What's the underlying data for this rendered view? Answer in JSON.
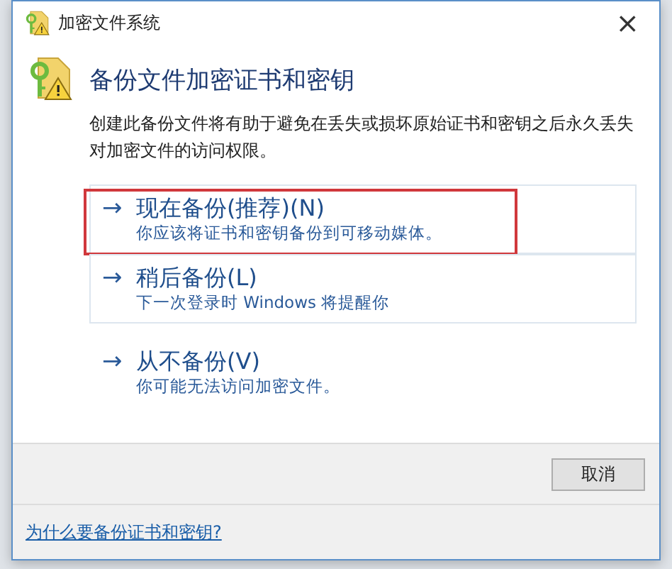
{
  "window": {
    "title": "加密文件系统",
    "close": "×"
  },
  "heading": "备份文件加密证书和密钥",
  "description": "创建此备份文件将有助于避免在丢失或损坏原始证书和密钥之后永久丢失对加密文件的访问权限。",
  "options": [
    {
      "arrow": "→",
      "title": "现在备份(推荐)(N)",
      "subtitle": "你应该将证书和密钥备份到可移动媒体。",
      "bordered": true,
      "highlighted": true
    },
    {
      "arrow": "→",
      "title": "稍后备份(L)",
      "subtitle": "下一次登录时 Windows 将提醒你",
      "bordered": true,
      "highlighted": false
    },
    {
      "arrow": "→",
      "title": "从不备份(V)",
      "subtitle": "你可能无法访问加密文件。",
      "bordered": false,
      "highlighted": false
    }
  ],
  "buttons": [
    "取消"
  ],
  "footer_link": "为什么要备份证书和密钥?"
}
